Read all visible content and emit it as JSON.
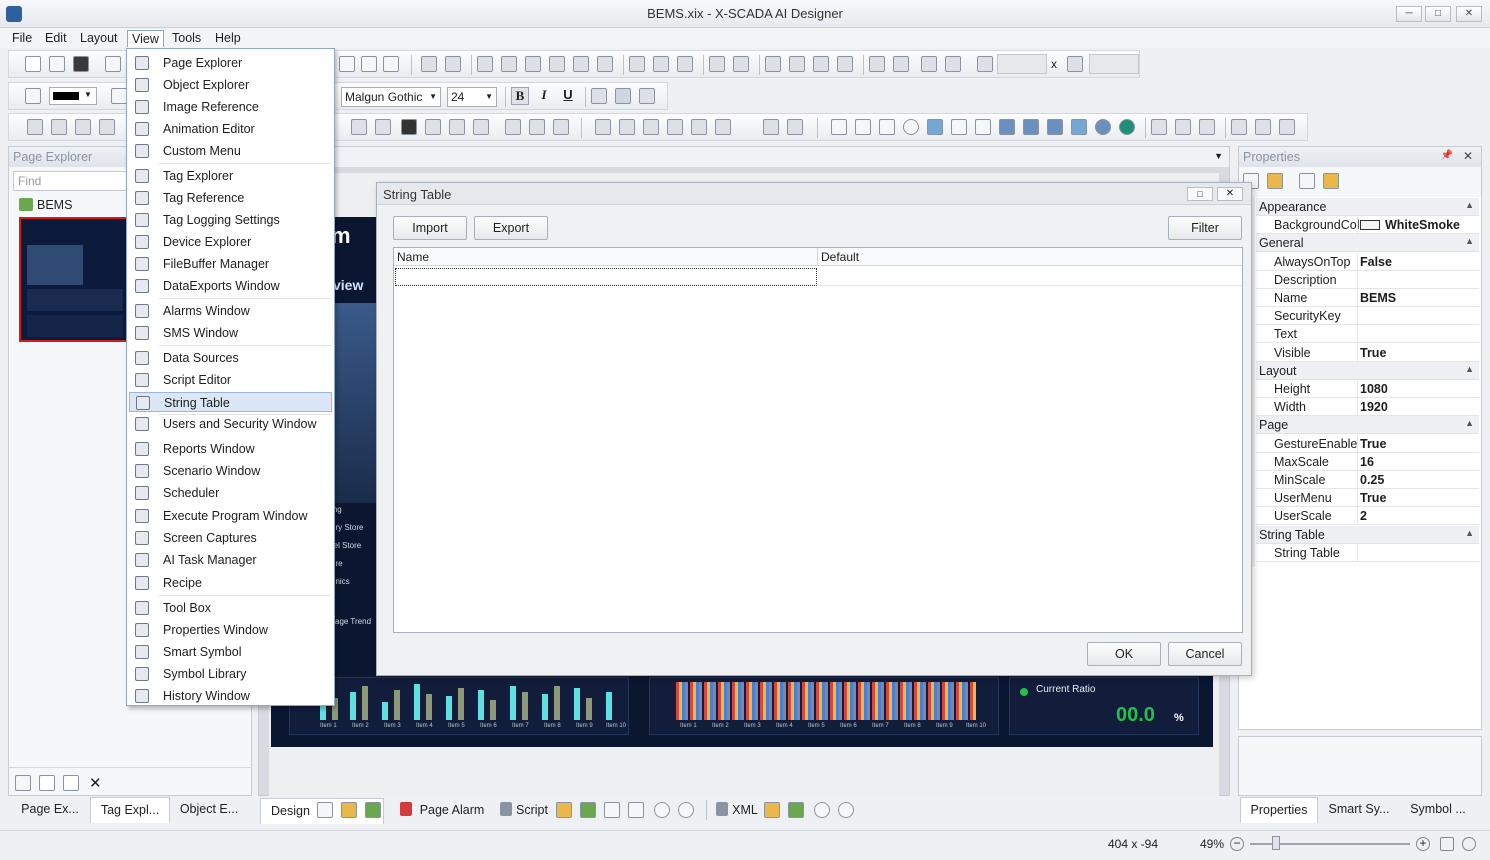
{
  "window": {
    "title": "BEMS.xix - X-SCADA AI Designer",
    "min": "─",
    "max": "□",
    "close": "✕"
  },
  "menubar": [
    "File",
    "Edit",
    "Layout",
    "View",
    "Tools",
    "Help"
  ],
  "toolbar": {
    "font": "Malgun Gothic",
    "font_size": "24",
    "bold": "B",
    "italic": "I",
    "underline": "U",
    "size_x": "x"
  },
  "left_panel": {
    "title": "Page Explorer",
    "find_placeholder": "Find",
    "root": "BEMS",
    "tabs": [
      "Page Ex...",
      "Tag Expl...",
      "Object E..."
    ]
  },
  "view_menu": {
    "items": [
      "Page Explorer",
      "Object Explorer",
      "Image Reference",
      "Animation Editor",
      "Custom Menu",
      "Tag Explorer",
      "Tag Reference",
      "Tag Logging Settings",
      "Device Explorer",
      "FileBuffer Manager",
      "DataExports Window",
      "Alarms Window",
      "SMS Window",
      "Data Sources",
      "Script Editor",
      "String Table",
      "Users and Security Window",
      "Reports Window",
      "Scenario Window",
      "Scheduler",
      "Execute Program Window",
      "Screen Captures",
      "AI Task Manager",
      "Recipe",
      "Tool Box",
      "Properties Window",
      "Smart Symbol",
      "Symbol Library",
      "History Window"
    ],
    "highlighted": "String Table"
  },
  "dialog": {
    "title": "String Table",
    "import": "Import",
    "export": "Export",
    "filter": "Filter",
    "col_name": "Name",
    "col_default": "Default",
    "ok": "OK",
    "cancel": "Cancel"
  },
  "canvas": {
    "overview_title": "m",
    "overview_sub": "view",
    "labels": [
      "ing",
      "ery Store",
      "rel Store",
      "ure",
      "onics",
      "sage Trend"
    ],
    "current_ratio_label": "Current Ratio",
    "current_ratio_value": "00.0",
    "current_ratio_unit": "%",
    "bar_labels": [
      "Item 1",
      "Item 2",
      "Item 3",
      "Item 4",
      "Item 5",
      "Item 6",
      "Item 7",
      "Item 8",
      "Item 9",
      "Item 10"
    ]
  },
  "bottom_tabs": {
    "design": "Design",
    "page_alarm": "Page Alarm",
    "script": "Script",
    "xml": "XML"
  },
  "properties": {
    "title": "Properties",
    "rows": [
      {
        "cat": "Appearance"
      },
      {
        "k": "BackgroundColor",
        "v": "WhiteSmoke",
        "swatch": true
      },
      {
        "cat": "General"
      },
      {
        "k": "AlwaysOnTop",
        "v": "False"
      },
      {
        "k": "Description",
        "v": ""
      },
      {
        "k": "Name",
        "v": "BEMS"
      },
      {
        "k": "SecurityKey",
        "v": ""
      },
      {
        "k": "Text",
        "v": ""
      },
      {
        "k": "Visible",
        "v": "True"
      },
      {
        "cat": "Layout"
      },
      {
        "k": "Height",
        "v": "1080"
      },
      {
        "k": "Width",
        "v": "1920"
      },
      {
        "cat": "Page"
      },
      {
        "k": "GestureEnable",
        "v": "True"
      },
      {
        "k": "MaxScale",
        "v": "16"
      },
      {
        "k": "MinScale",
        "v": "0.25"
      },
      {
        "k": "UserMenu",
        "v": "True"
      },
      {
        "k": "UserScale",
        "v": "2"
      },
      {
        "cat": "String Table"
      },
      {
        "k": "String Table",
        "v": ""
      }
    ],
    "tabs": [
      "Properties",
      "Smart Sy...",
      "Symbol ..."
    ]
  },
  "status": {
    "coords": "404 x -94",
    "zoom": "49%"
  },
  "colors": {
    "accent": "#3a6fb0",
    "canvas_bg": "#0b1630",
    "value_green": "#22c24a",
    "teal": "#5ee0e0"
  }
}
